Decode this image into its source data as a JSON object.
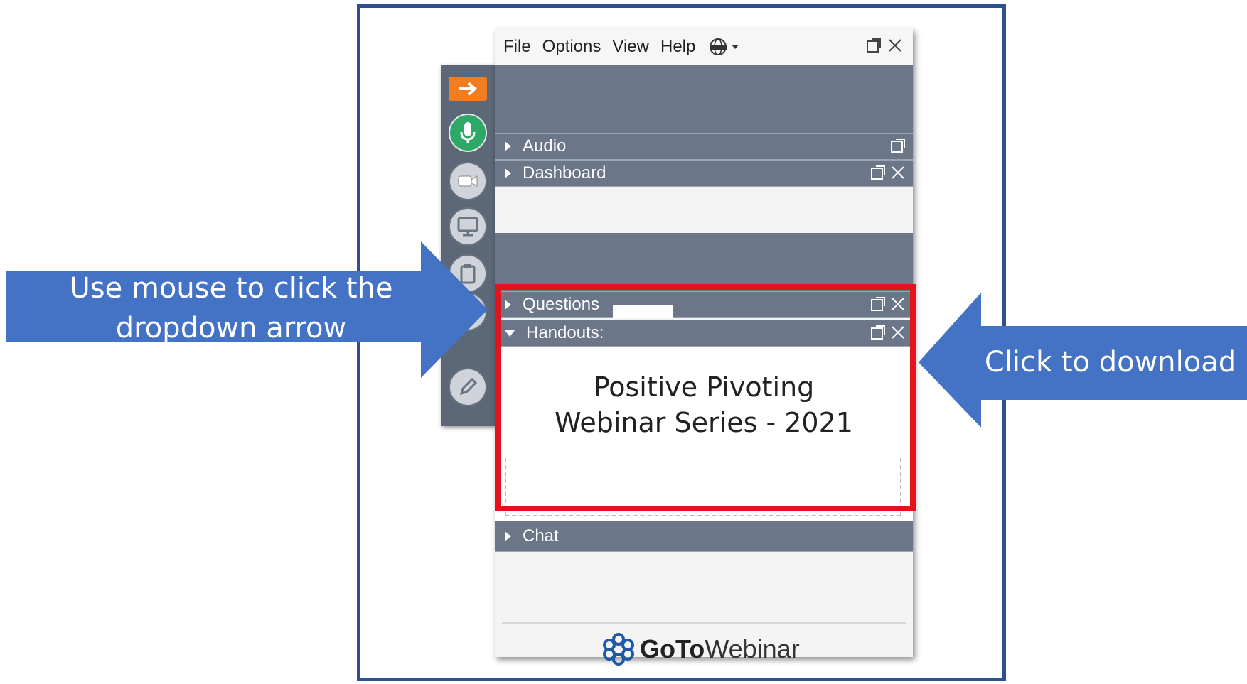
{
  "menubar": {
    "items": [
      "File",
      "Options",
      "View",
      "Help"
    ]
  },
  "panels": {
    "audio": "Audio",
    "dashboard": "Dashboard",
    "questions": "Questions",
    "handouts": "Handouts:",
    "chat": "Chat"
  },
  "handout": {
    "line1": "Positive Pivoting",
    "line2": "Webinar Series - 2021"
  },
  "logo": {
    "bold": "GoTo",
    "rest": "Webinar"
  },
  "callouts": {
    "left_line1": "Use mouse to click the",
    "left_line2": "dropdown arrow",
    "right": "Click to download"
  },
  "colors": {
    "frame": "#2f4f8f",
    "callout_blue": "#4472c4",
    "highlight_red": "#e3121d",
    "panel_bar": "#6c7689",
    "mic_green": "#2ea866",
    "accent_orange": "#f07d22"
  },
  "icons": [
    "exit-arrow-icon",
    "microphone-icon",
    "webcam-icon",
    "screen-share-icon",
    "clipboard-icon",
    "pencil-icon",
    "globe-icon",
    "popout-icon",
    "close-icon",
    "gotowebinar-logo-icon"
  ]
}
